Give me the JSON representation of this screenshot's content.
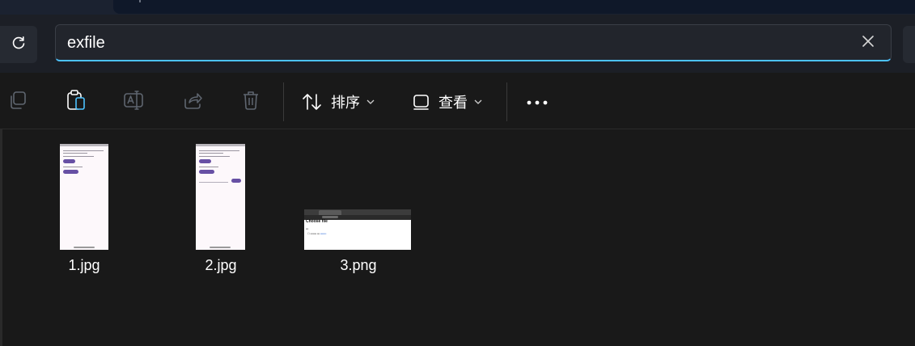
{
  "address_bar": {
    "search_value": "exfile",
    "refresh_icon": "refresh-icon",
    "clear_icon": "close-icon"
  },
  "toolbar": {
    "icons": [
      "copy-icon",
      "paste-icon",
      "rename-icon",
      "share-icon",
      "delete-icon"
    ],
    "sort_label": "排序",
    "view_label": "查看",
    "more_icon": "more-icon"
  },
  "files": [
    {
      "name": "1.jpg",
      "kind": "phone-screenshot"
    },
    {
      "name": "2.jpg",
      "kind": "phone-screenshot"
    },
    {
      "name": "3.png",
      "kind": "browser-screenshot"
    }
  ],
  "thumbnail_text": {
    "browser_heading": "Choose file"
  },
  "colors": {
    "accent": "#4cc2ff",
    "background": "#191919",
    "paste_icon_accent": "#4cc2ff",
    "thumb_pill": "#6750a4"
  }
}
